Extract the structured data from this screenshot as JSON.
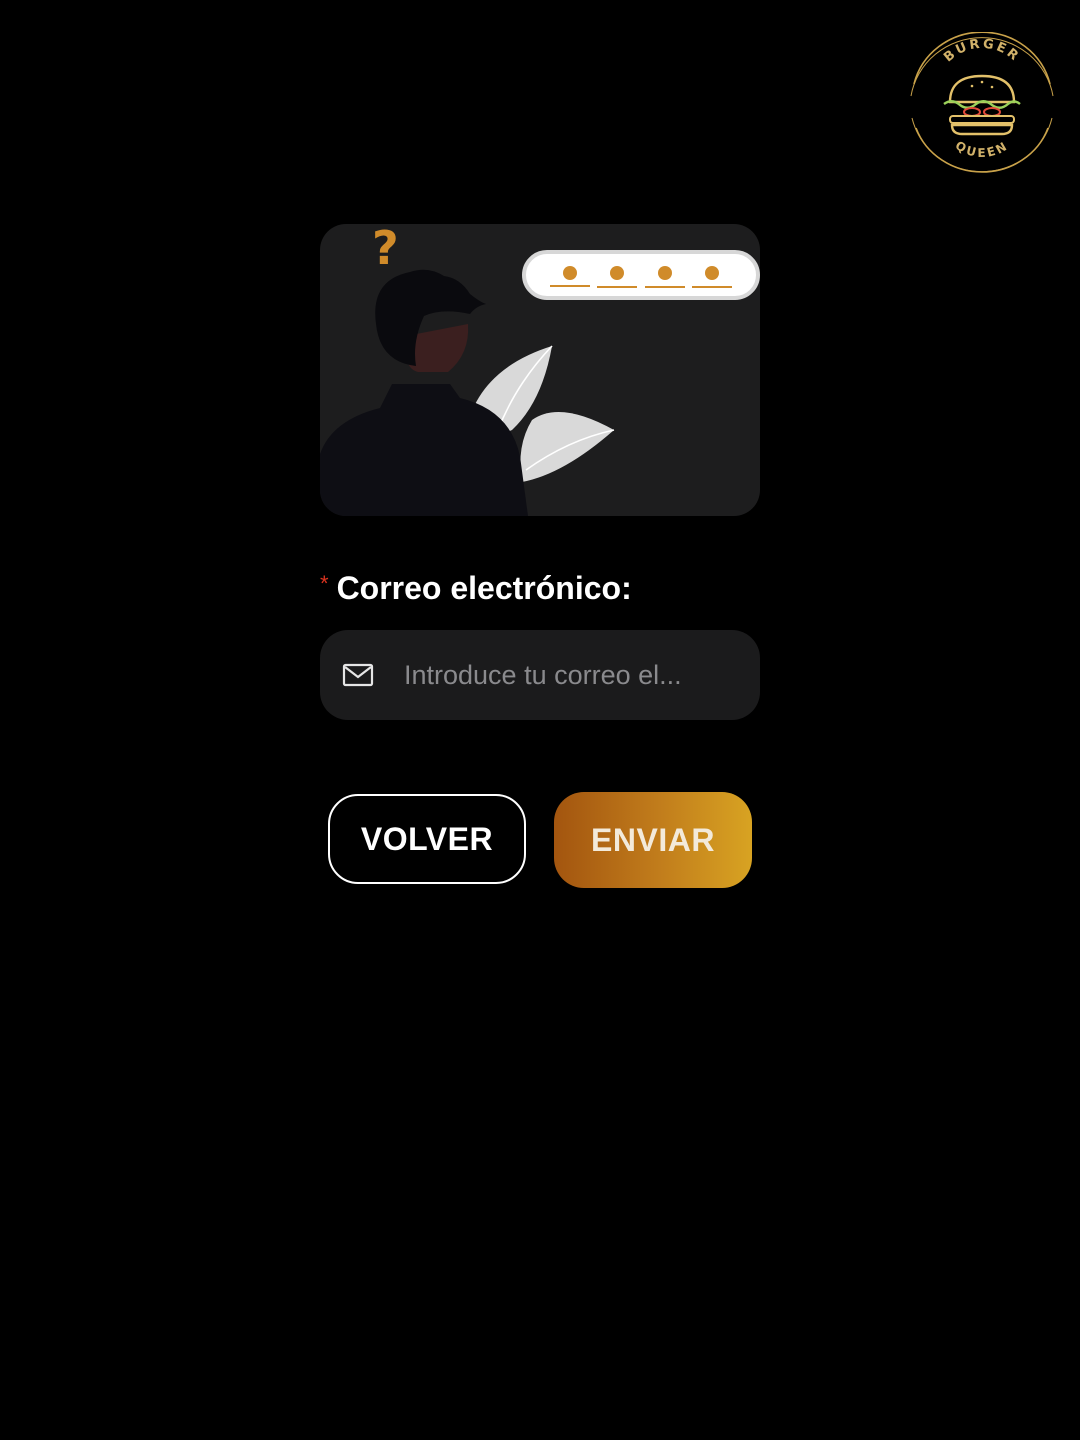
{
  "logo": {
    "top_text": "BURGER",
    "bottom_text": "QUEEN",
    "icon": "burger-logo",
    "color": "#c9a24a"
  },
  "illustration": {
    "icon": "forgot-password-illustration",
    "question_mark": "?",
    "password_dots_count": 4,
    "accent_color": "#d08b2a"
  },
  "form": {
    "required_marker": "*",
    "email_label": "Correo electrónico:",
    "email_placeholder": "Introduce tu correo el...",
    "email_value": "",
    "email_icon": "mail-icon"
  },
  "actions": {
    "back_label": "VOLVER",
    "send_label": "ENVIAR"
  },
  "colors": {
    "background": "#000000",
    "card": "#1d1d1e",
    "required": "#d9331f",
    "gradient_start": "#a3550f",
    "gradient_end": "#d8a322"
  }
}
